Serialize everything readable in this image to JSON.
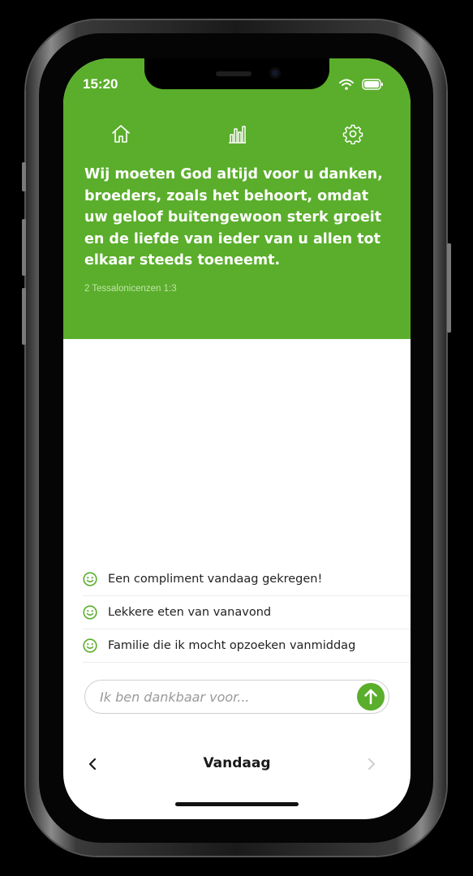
{
  "status_bar": {
    "time": "15:20"
  },
  "nav": {
    "icons": [
      "home-icon",
      "stats-icon",
      "gear-icon"
    ]
  },
  "verse": {
    "text": "Wij moeten God altijd voor u danken, broeders, zoals het behoort, omdat uw geloof buitengewoon sterk groeit en de liefde van ieder van u allen tot elkaar steeds toeneemt.",
    "reference": "2 Tessalonicenzen 1:3"
  },
  "gratitude_list": [
    {
      "icon": "smiley-icon",
      "text": "Een compliment vandaag gekregen!"
    },
    {
      "icon": "smiley-icon",
      "text": "Lekkere eten van vanavond"
    },
    {
      "icon": "smiley-icon",
      "text": "Familie die ik mocht opzoeken vanmiddag"
    }
  ],
  "input": {
    "placeholder": "Ik ben dankbaar voor..."
  },
  "footer": {
    "day_label": "Vandaag"
  },
  "colors": {
    "accent": "#5aae2b",
    "text": "#1a1a1a"
  }
}
